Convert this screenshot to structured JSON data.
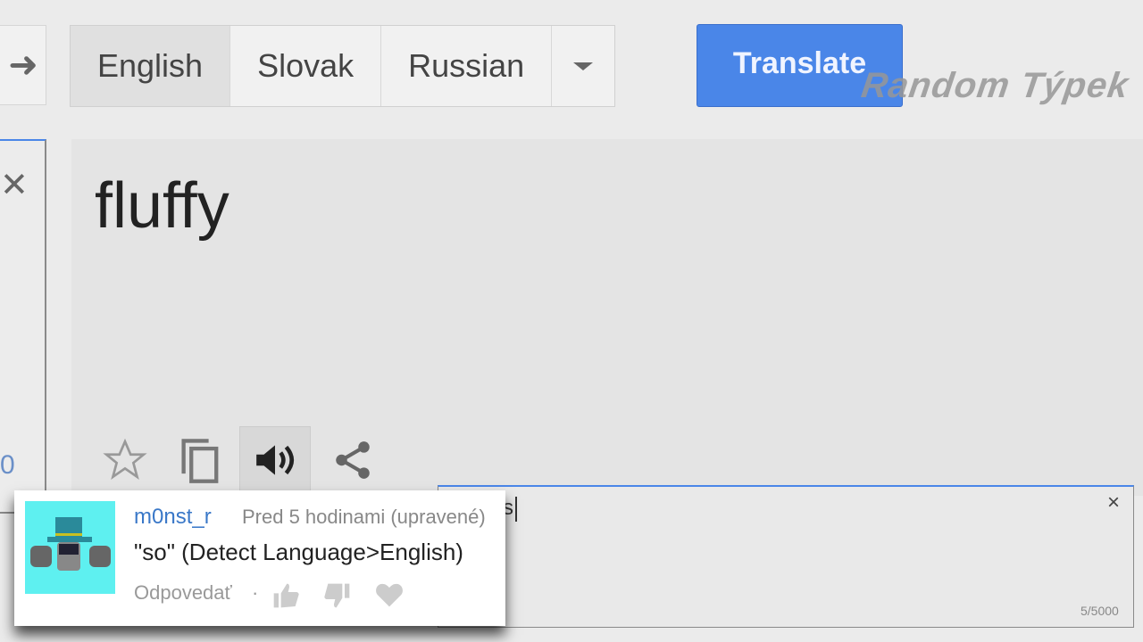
{
  "toolbar": {
    "swap_icon": "swap-arrow-icon",
    "languages": [
      "English",
      "Slovak",
      "Russian"
    ],
    "active_language": "English",
    "dropdown_icon": "chevron-down-icon",
    "translate_label": "Translate",
    "accent": "#4a86e8"
  },
  "watermark": "Random Týpek",
  "source_panel": {
    "close_icon": "close-icon",
    "counter_fragment": "0"
  },
  "result": {
    "text": "fluffy",
    "actions": [
      "star-icon",
      "copy-icon",
      "speaker-icon",
      "share-icon"
    ]
  },
  "input_box": {
    "text": "s",
    "close_icon": "close-icon",
    "char_count": "5/5000"
  },
  "comment": {
    "username": "m0nst_r",
    "timestamp": "Pred 5 hodinami (upravené)",
    "text": "\"so\" (Detect Language>English)",
    "reply_label": "Odpovedať",
    "separator": "·",
    "actions": [
      "thumbs-up-icon",
      "thumbs-down-icon",
      "heart-icon"
    ]
  }
}
